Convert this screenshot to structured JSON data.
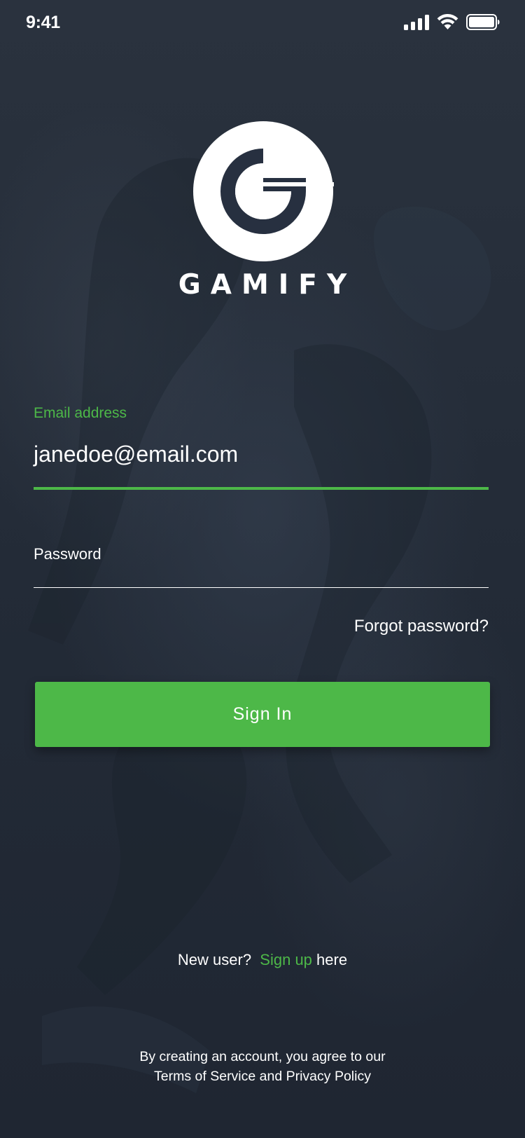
{
  "status_bar": {
    "time": "9:41",
    "icons": [
      "signal-icon",
      "wifi-icon",
      "battery-icon"
    ]
  },
  "brand": {
    "logo_icon": "gamify-logo-icon",
    "name": "GAMIFY"
  },
  "form": {
    "email_label": "Email address",
    "email_value": "janedoe@email.com",
    "password_label": "Password",
    "forgot_password": "Forgot password?",
    "sign_in_label": "Sign In"
  },
  "signup": {
    "prefix": "New user?",
    "link": "Sign up",
    "suffix": "here"
  },
  "terms": {
    "line1": "By creating an account, you agree to our",
    "line2": "Terms of Service and Privacy Policy"
  },
  "colors": {
    "accent": "#4db848",
    "background": "#232b37",
    "text": "#ffffff"
  }
}
